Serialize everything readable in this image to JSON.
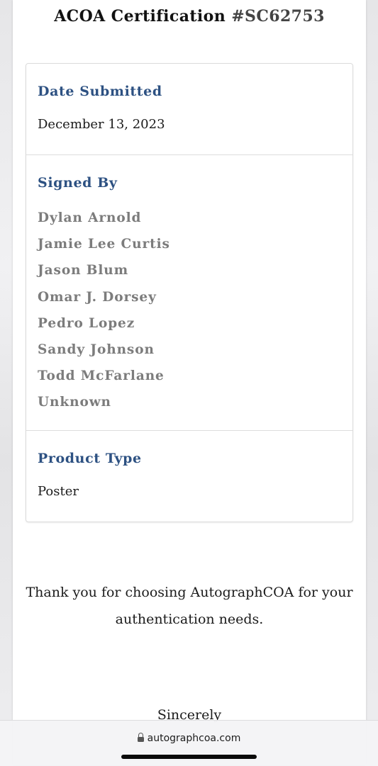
{
  "certificate": {
    "title_prefix": "ACOA Certification ",
    "title_number": "#SC62753"
  },
  "details": {
    "date_label": "Date Submitted",
    "date_value": "December 13, 2023",
    "signed_label": "Signed By",
    "signers": [
      "Dylan Arnold",
      "Jamie Lee Curtis",
      "Jason Blum",
      "Omar J. Dorsey",
      "Pedro Lopez",
      "Sandy Johnson",
      "Todd McFarlane",
      "Unknown"
    ],
    "product_label": "Product Type",
    "product_value": "Poster"
  },
  "footer": {
    "thanks_text": "Thank you for choosing AutographCOA for your authentication needs.",
    "sincerely": "Sincerely"
  },
  "browser": {
    "url": "autographcoa.com",
    "lock_icon": "lock-icon"
  },
  "colors": {
    "label_blue": "#2d5182",
    "signer_gray": "#7c7c7c",
    "text_dark": "#1b1b1b"
  }
}
